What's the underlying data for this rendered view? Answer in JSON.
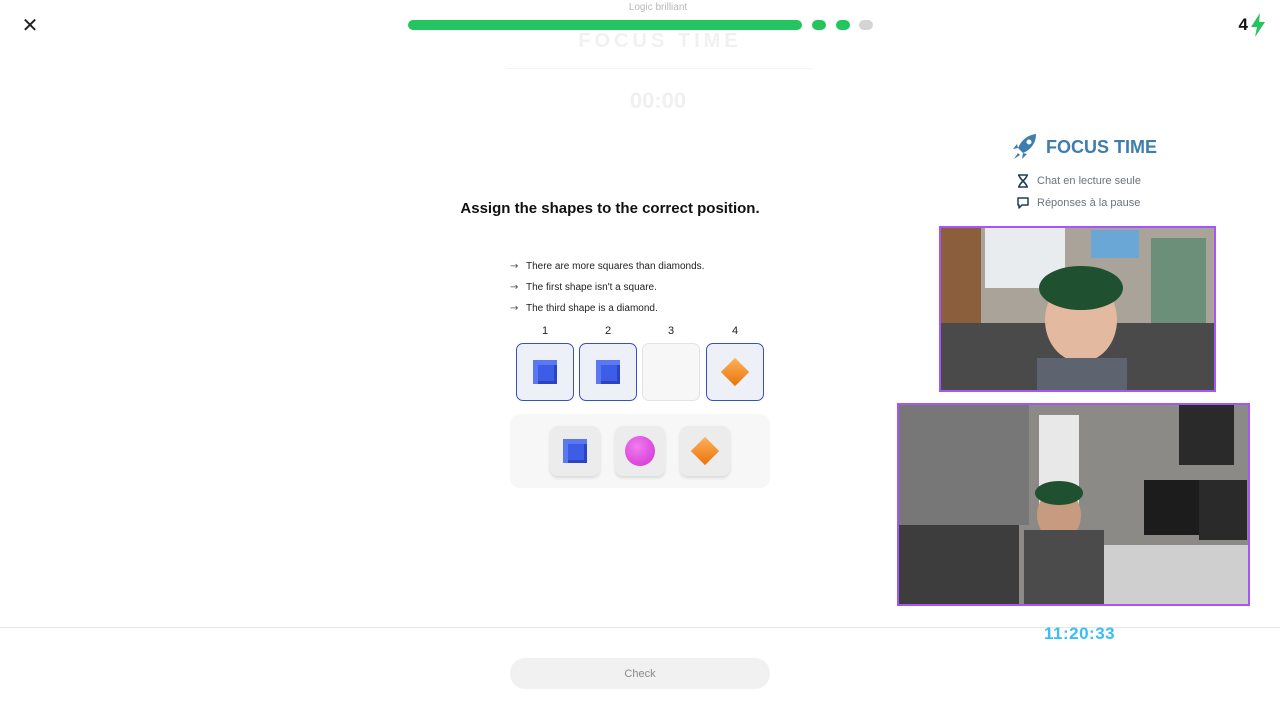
{
  "header": {
    "overlay_title": "Logic brilliant",
    "progress_colors": {
      "done": "#22c55e",
      "pending": "#d4d4d4"
    },
    "streak_count": "4",
    "ghost_focus": "FOCUS TIME",
    "ghost_timer": "00:00"
  },
  "lesson": {
    "question": "Assign the shapes to the correct position.",
    "clues": [
      "There are more squares than diamonds.",
      "The first shape isn't a square.",
      "The third shape is a diamond."
    ],
    "slot_numbers": [
      "1",
      "2",
      "3",
      "4"
    ],
    "slots": [
      "square",
      "square",
      "empty",
      "diamond"
    ],
    "tray_pieces": [
      "square",
      "circle",
      "diamond"
    ],
    "check_label": "Check"
  },
  "stream": {
    "focus_title": "FOCUS TIME",
    "read_only_chat": "Chat en lecture seule",
    "paused_answers": "Réponses à la pause",
    "clock": "11:20:33",
    "accent_color": "#a855f7"
  }
}
